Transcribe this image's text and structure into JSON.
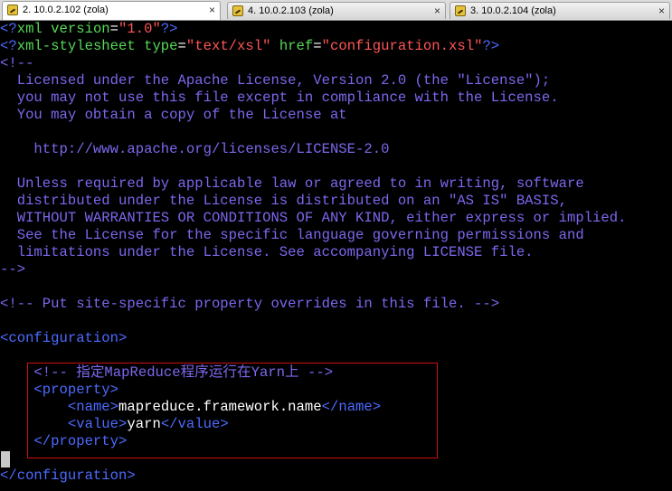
{
  "tabs": [
    {
      "label": "2. 10.0.2.102 (zola)",
      "close": "×",
      "active": true,
      "icon": "putty-icon"
    },
    {
      "label": "4. 10.0.2.103 (zola)",
      "close": "×",
      "active": false,
      "icon": "putty-icon"
    },
    {
      "label": "3. 10.0.2.104 (zola)",
      "close": "×",
      "active": false,
      "icon": "putty-icon"
    }
  ],
  "editor": {
    "decl1": {
      "open": "<?",
      "name": "xml",
      "attr": " version",
      "eq": "=",
      "val": "\"1.0\"",
      "close": "?>"
    },
    "decl2": {
      "open": "<?",
      "name": "xml-stylesheet",
      "attr1": " type",
      "eq1": "=",
      "val1": "\"text/xsl\"",
      "attr2": " href",
      "eq2": "=",
      "val2": "\"configuration.xsl\"",
      "close": "?>"
    },
    "license": [
      "<!--",
      "  Licensed under the Apache License, Version 2.0 (the \"License\");",
      "  you may not use this file except in compliance with the License.",
      "  You may obtain a copy of the License at",
      "",
      "    http://www.apache.org/licenses/LICENSE-2.0",
      "",
      "  Unless required by applicable law or agreed to in writing, software",
      "  distributed under the License is distributed on an \"AS IS\" BASIS,",
      "  WITHOUT WARRANTIES OR CONDITIONS OF ANY KIND, either express or implied.",
      "  See the License for the specific language governing permissions and",
      "  limitations under the License. See accompanying LICENSE file.",
      "-->"
    ],
    "site_comment": "<!-- Put site-specific property overrides in this file. -->",
    "config_open": "<configuration>",
    "yarn_comment": "    <!-- 指定MapReduce程序运行在Yarn上 -->",
    "prop_open": "    <property>",
    "name_indent": "        ",
    "name_open": "<name>",
    "name_value": "mapreduce.framework.name",
    "name_close": "</name>",
    "value_indent": "        ",
    "value_open": "<value>",
    "value_value": "yarn",
    "value_close": "</value>",
    "prop_close": "    </property>",
    "config_close": "</configuration>"
  }
}
